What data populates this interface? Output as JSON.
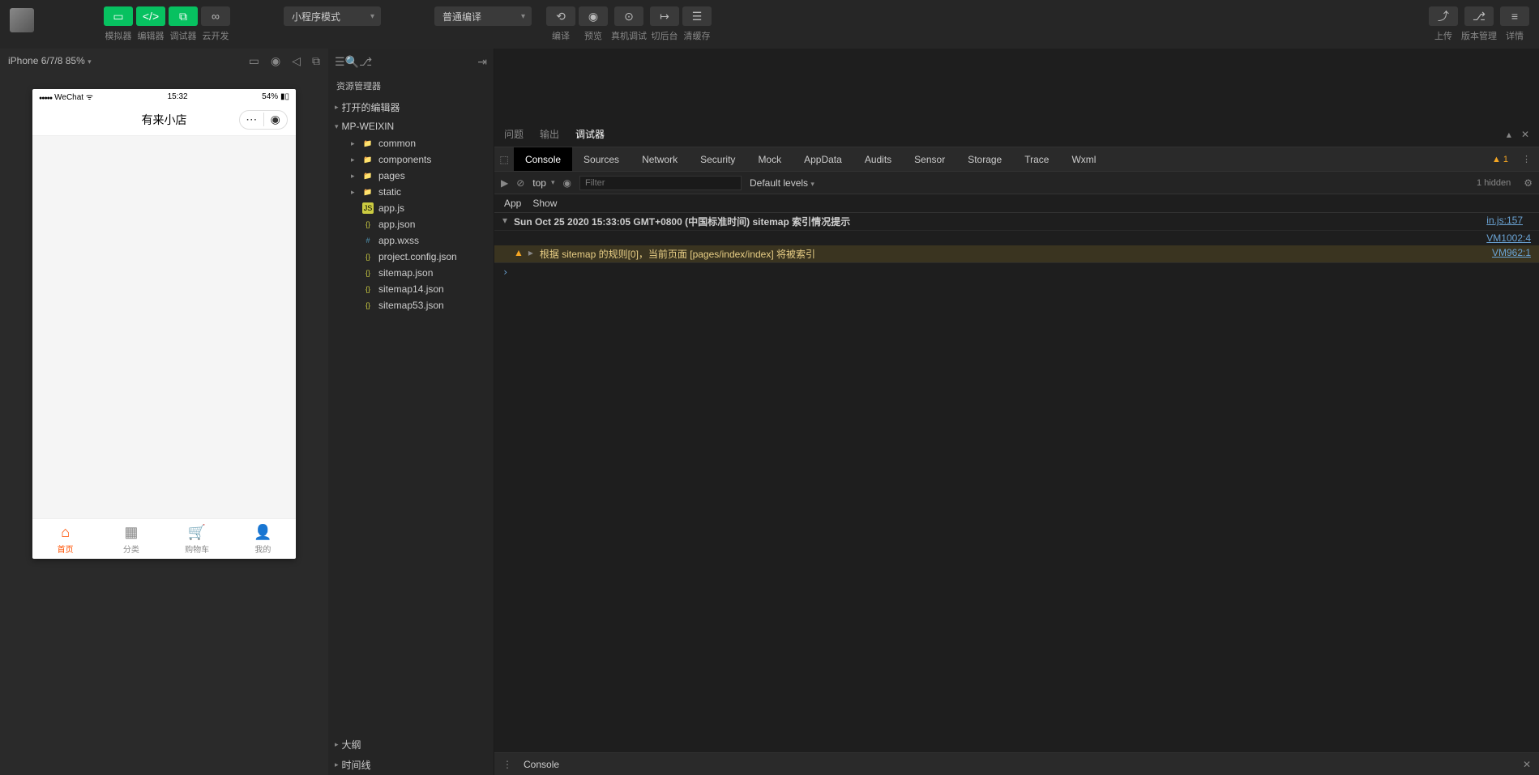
{
  "toolbar": {
    "simulator": "模拟器",
    "editor": "编辑器",
    "debugger": "调试器",
    "cloud": "云开发",
    "mode_select": "小程序模式",
    "compile_select": "普通编译",
    "compile": "编译",
    "preview": "预览",
    "remote_debug": "真机调试",
    "background": "切后台",
    "clear_cache": "清缓存",
    "upload": "上传",
    "version": "版本管理",
    "details": "详情"
  },
  "simulator": {
    "device": "iPhone 6/7/8 85%",
    "status_carrier": "WeChat",
    "status_time": "15:32",
    "status_battery": "54%",
    "app_title": "有来小店",
    "tabs": [
      {
        "label": "首页",
        "icon": "⌂"
      },
      {
        "label": "分类",
        "icon": "▦"
      },
      {
        "label": "购物车",
        "icon": "🛒"
      },
      {
        "label": "我的",
        "icon": "👤"
      }
    ]
  },
  "explorer": {
    "title": "资源管理器",
    "open_editors": "打开的编辑器",
    "root": "MP-WEIXIN",
    "outline": "大纲",
    "timeline": "时间线",
    "items": [
      {
        "name": "common",
        "type": "folder-closed",
        "expandable": true
      },
      {
        "name": "components",
        "type": "folder",
        "expandable": true
      },
      {
        "name": "pages",
        "type": "folder",
        "expandable": true
      },
      {
        "name": "static",
        "type": "folder",
        "expandable": true
      },
      {
        "name": "app.js",
        "type": "js",
        "expandable": false
      },
      {
        "name": "app.json",
        "type": "json",
        "expandable": false
      },
      {
        "name": "app.wxss",
        "type": "wxss",
        "expandable": false
      },
      {
        "name": "project.config.json",
        "type": "json",
        "expandable": false
      },
      {
        "name": "sitemap.json",
        "type": "json",
        "expandable": false
      },
      {
        "name": "sitemap14.json",
        "type": "json",
        "expandable": false
      },
      {
        "name": "sitemap53.json",
        "type": "json",
        "expandable": false
      }
    ]
  },
  "debugger": {
    "tabs": {
      "problems": "问题",
      "output": "输出",
      "debugger": "调试器"
    },
    "devtools": [
      "Console",
      "Sources",
      "Network",
      "Security",
      "Mock",
      "AppData",
      "Audits",
      "Sensor",
      "Storage",
      "Trace",
      "Wxml"
    ],
    "warn_count": "1",
    "context": "top",
    "filter_placeholder": "Filter",
    "levels": "Default levels",
    "hidden": "1 hidden",
    "app": "App",
    "show": "Show",
    "log1_text": "Sun Oct 25 2020 15:33:05 GMT+0800 (中国标准时间) sitemap 索引情况提示",
    "log1_src": "VM1002:4",
    "log1_src2": "in.js:157",
    "log2_pre": "根据 sitemap 的规则[0]，当前页面 [pages/index/index] 将被索引",
    "log2_src": "VM962:1",
    "drawer_console": "Console"
  }
}
